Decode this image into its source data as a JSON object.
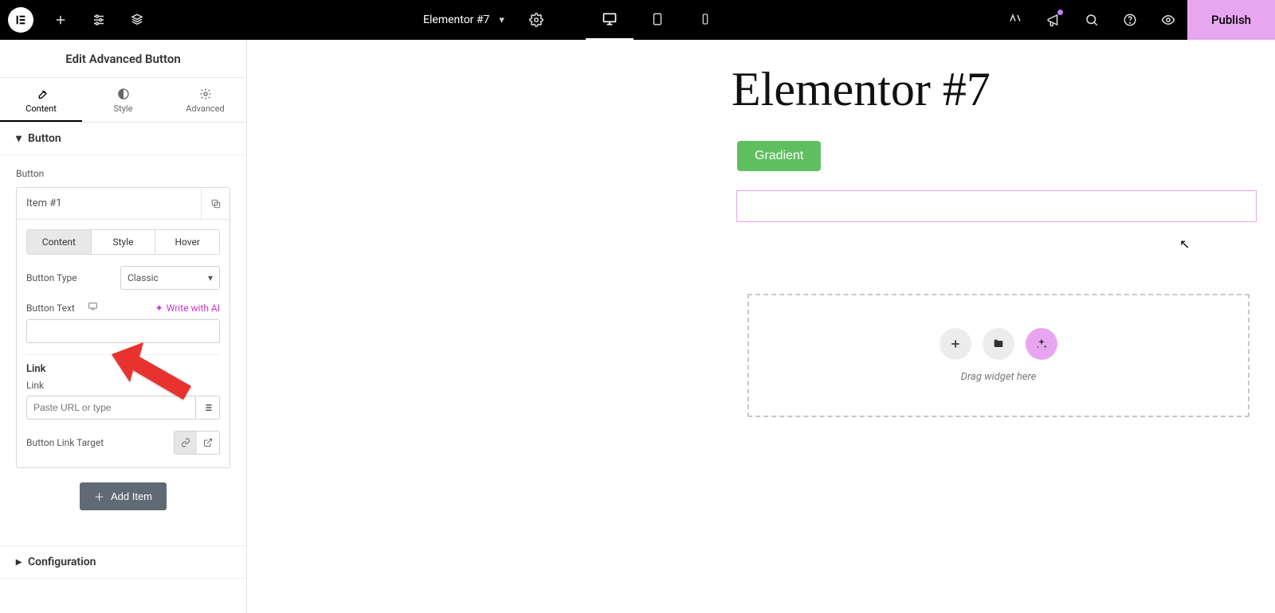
{
  "topbar": {
    "doc_title": "Elementor #7",
    "publish_label": "Publish"
  },
  "panel": {
    "title": "Edit Advanced Button",
    "tabs": {
      "content": "Content",
      "style": "Style",
      "advanced": "Advanced"
    }
  },
  "section": {
    "button_header": "Button",
    "button_label": "Button",
    "item_title": "Item #1",
    "subtabs": {
      "content": "Content",
      "style": "Style",
      "hover": "Hover"
    },
    "button_type_label": "Button Type",
    "button_type_value": "Classic",
    "button_text_label": "Button Text",
    "write_ai": "Write with AI",
    "button_text_value": "",
    "link_header": "Link",
    "link_label": "Link",
    "link_placeholder": "Paste URL or type",
    "link_target_label": "Button Link Target",
    "add_item": "Add Item",
    "configuration_header": "Configuration"
  },
  "canvas": {
    "page_title": "Elementor #7",
    "gradient_button": "Gradient",
    "drop_text": "Drag widget here"
  }
}
